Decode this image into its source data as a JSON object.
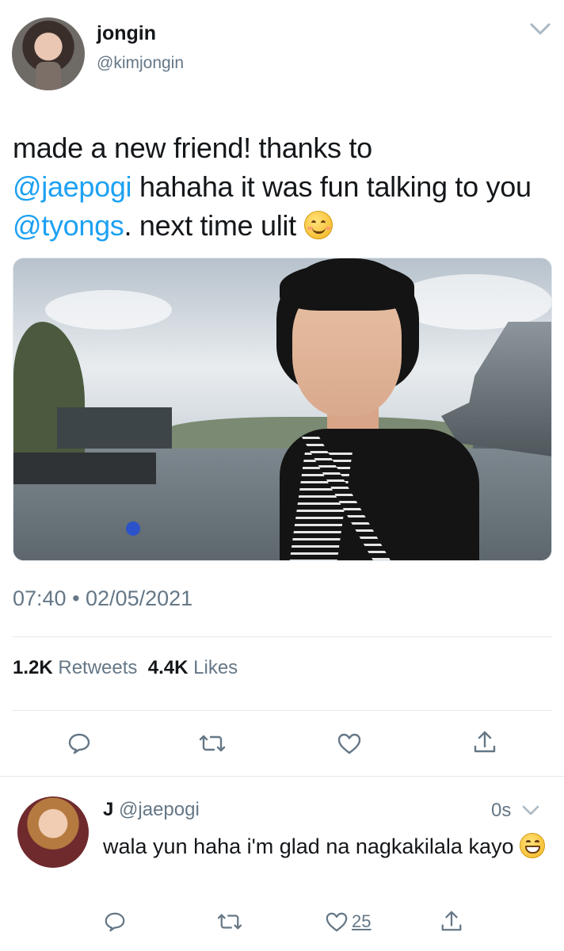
{
  "tweet": {
    "author": {
      "display_name": "jongin",
      "handle": "@kimjongin"
    },
    "text_parts": {
      "p1": "made a new friend! thanks to",
      "m1": "@jaepogi",
      "p2": " hahaha it was fun talking to you ",
      "m2": "@tyongs",
      "p3": ". next time ulit "
    },
    "emoji": "smiling-face-with-smiling-eyes",
    "timestamp": "07:40 • 02/05/2021",
    "stats": {
      "retweets_count": "1.2K",
      "retweets_label": "Retweets",
      "likes_count": "4.4K",
      "likes_label": "Likes"
    },
    "actions": [
      "reply-icon",
      "retweet-icon",
      "like-icon",
      "share-icon"
    ]
  },
  "reply": {
    "author": {
      "display_name": "J",
      "handle": "@jaepogi"
    },
    "time": "0s",
    "text": "wala yun haha i'm glad na nagkakilala kayo ",
    "emoji": "grinning-face-with-smiling-eyes",
    "like_count": "25",
    "actions": [
      "reply-icon",
      "retweet-icon",
      "like-icon",
      "share-icon"
    ]
  },
  "colors": {
    "text": "#14171a",
    "secondary": "#657786",
    "link": "#1da1f2",
    "divider": "#e1e8ed"
  }
}
